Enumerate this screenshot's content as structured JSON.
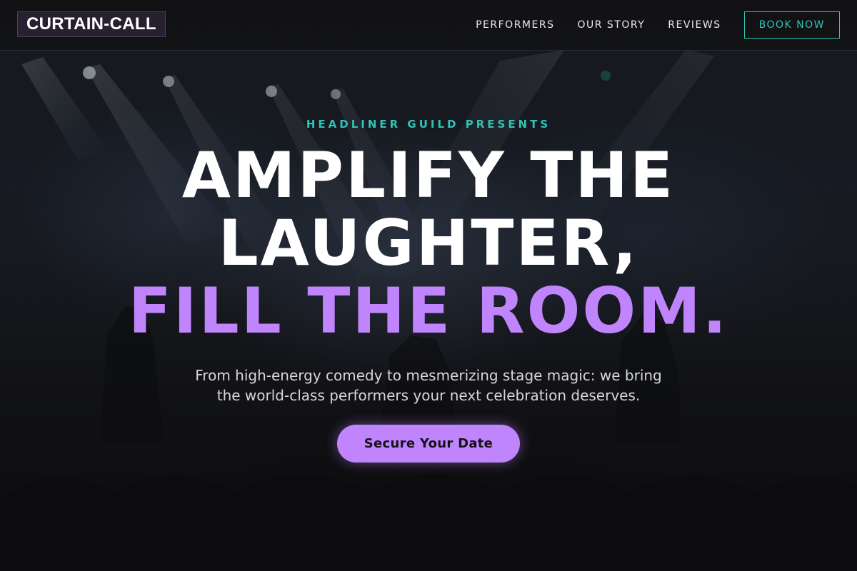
{
  "brand": {
    "logo_text": "CURTAIN-CALL"
  },
  "nav": {
    "links": [
      {
        "label": "PERFORMERS"
      },
      {
        "label": "OUR STORY"
      },
      {
        "label": "REVIEWS"
      }
    ],
    "book_label": "BOOK NOW"
  },
  "hero": {
    "eyebrow": "HEADLINER GUILD PRESENTS",
    "headline_line1": "AMPLIFY THE",
    "headline_line2": "LAUGHTER,",
    "headline_line3": "FILL THE ROOM.",
    "subtext_line1": "From high-energy comedy to mesmerizing stage magic: we bring",
    "subtext_line2": "the world-class performers your next celebration deserves.",
    "cta_label": "Secure Your Date",
    "background_image": "concert-stage-photo"
  },
  "colors": {
    "accent_teal": "#2ec4b6",
    "accent_purple": "#c084fc",
    "background": "#121214"
  }
}
